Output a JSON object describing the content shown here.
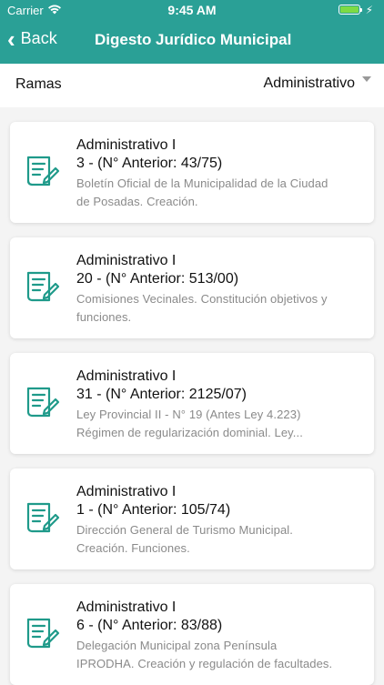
{
  "status": {
    "carrier": "Carrier",
    "time": "9:45 AM",
    "bolt": "⚡"
  },
  "nav": {
    "back_label": "Back",
    "title": "Digesto Jurídico Municipal"
  },
  "filter": {
    "label": "Ramas",
    "selected": "Administrativo"
  },
  "colors": {
    "primary": "#2aa096"
  },
  "items": [
    {
      "branch": "Administrativo I",
      "number": "3 - (N° Anterior: 43/75)",
      "desc_line1": "Boletín Oficial de la Municipalidad de la Ciudad",
      "desc_line2": "de Posadas. Creación."
    },
    {
      "branch": "Administrativo I",
      "number": "20 - (N° Anterior: 513/00)",
      "desc_line1": "Comisiones Vecinales. Constitución objetivos y",
      "desc_line2": "funciones."
    },
    {
      "branch": "Administrativo I",
      "number": "31 - (N° Anterior: 2125/07)",
      "desc_line1": "Ley Provincial II - N° 19 (Antes Ley 4.223)",
      "desc_line2": "Régimen de regularización dominial. Ley..."
    },
    {
      "branch": "Administrativo I",
      "number": "1 - (N° Anterior: 105/74)",
      "desc_line1": "Dirección General de Turismo Municipal.",
      "desc_line2": "Creación. Funciones."
    },
    {
      "branch": "Administrativo I",
      "number": "6 - (N° Anterior: 83/88)",
      "desc_line1": "Delegación Municipal zona Península",
      "desc_line2": "IPRODHA. Creación y regulación de facultades."
    }
  ]
}
